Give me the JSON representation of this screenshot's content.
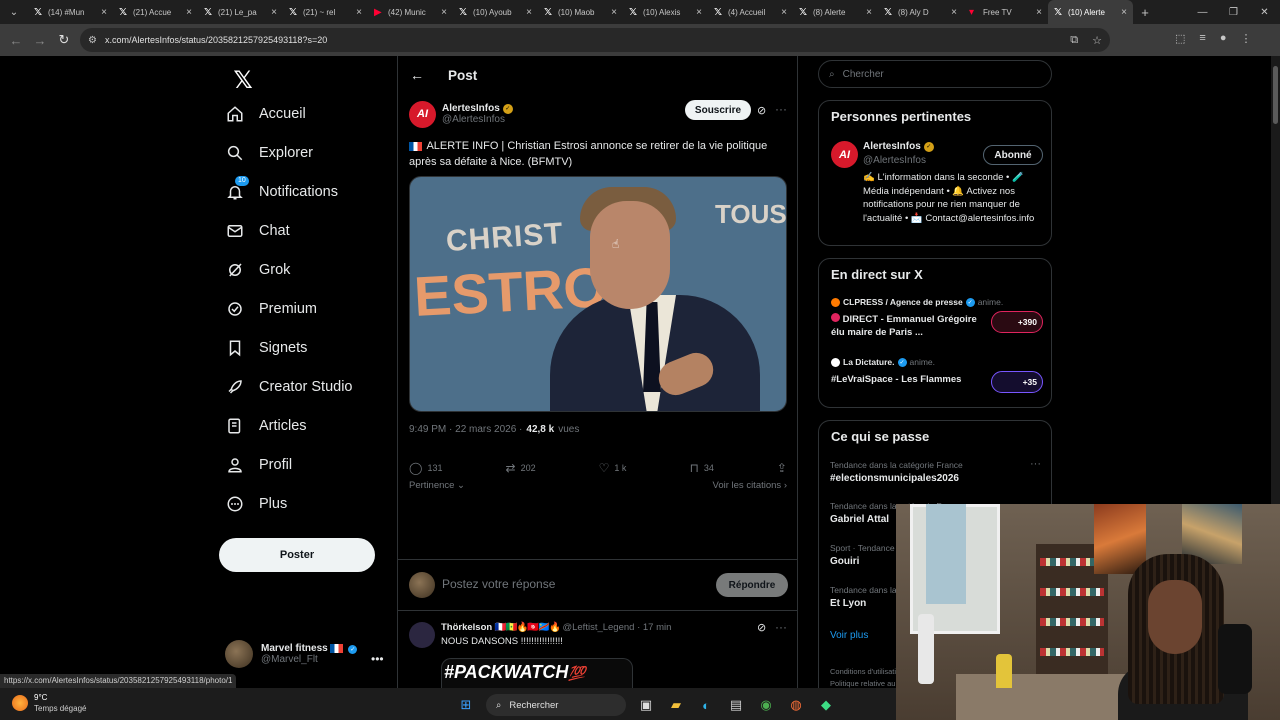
{
  "browser": {
    "tabs": [
      {
        "icon": "x-logo-icon",
        "title": "(14) #Mun"
      },
      {
        "icon": "x-logo-icon",
        "title": "(21) Accue"
      },
      {
        "icon": "x-logo-icon",
        "title": "(21) Le_pa"
      },
      {
        "icon": "x-logo-icon",
        "title": "(21) ~ rel"
      },
      {
        "icon": "youtube-icon",
        "title": "(42) Munic"
      },
      {
        "icon": "x-logo-icon",
        "title": "(10) Ayoub"
      },
      {
        "icon": "x-logo-icon",
        "title": "(10) Maob"
      },
      {
        "icon": "x-logo-icon",
        "title": "(10) Alexis"
      },
      {
        "icon": "x-logo-icon",
        "title": "(4) Accueil"
      },
      {
        "icon": "x-logo-icon",
        "title": "(8) Alerte"
      },
      {
        "icon": "x-logo-icon",
        "title": "(8) Aly D"
      },
      {
        "icon": "freetv-icon",
        "title": "Free TV"
      },
      {
        "icon": "x-logo-icon",
        "title": "(10) Alerte"
      }
    ],
    "url": "x.com/AlertesInfos/status/2035821257925493118?s=20",
    "status_url": "https://x.com/AlertesInfos/status/2035821257925493118/photo/1"
  },
  "sidebar": {
    "items": [
      {
        "icon": "home-icon",
        "label": "Accueil"
      },
      {
        "icon": "search-icon",
        "label": "Explorer"
      },
      {
        "icon": "bell-icon",
        "label": "Notifications",
        "badge": "10"
      },
      {
        "icon": "mail-icon",
        "label": "Chat"
      },
      {
        "icon": "grok-icon",
        "label": "Grok"
      },
      {
        "icon": "verified-icon",
        "label": "Premium"
      },
      {
        "icon": "bookmark-icon",
        "label": "Signets"
      },
      {
        "icon": "rocket-icon",
        "label": "Creator Studio"
      },
      {
        "icon": "article-icon",
        "label": "Articles"
      },
      {
        "icon": "person-icon",
        "label": "Profil"
      },
      {
        "icon": "more-circle-icon",
        "label": "Plus"
      }
    ],
    "post_label": "Poster",
    "account": {
      "name": "Marvel fitness",
      "handle": "@Marvel_Flt"
    }
  },
  "main": {
    "title": "Post",
    "post": {
      "author_name": "AlertesInfos",
      "author_handle": "@AlertesInfos",
      "subscribe_label": "Souscrire",
      "text": "ALERTE INFO | Christian Estrosi annonce se retirer de la vie politique après sa défaite à Nice. (BFMTV)",
      "photo_text": {
        "line1": "CHRIST",
        "line2": "ESTRO",
        "line3": "TOUS"
      },
      "time": "9:49 PM · 22 mars 2026 ·",
      "views": "42,8 k",
      "views_label": "vues",
      "replies": "131",
      "reposts": "202",
      "likes": "1 k",
      "bookmarks": "34",
      "sort_label": "Pertinence",
      "quotes_label": "Voir les citations"
    },
    "reply_box": {
      "placeholder": "Postez votre réponse",
      "button": "Répondre"
    },
    "reply": {
      "name": "Thörkelson",
      "emojis": "🇫🇷🇸🇳🔥🇹🇳🇨🇩🔥",
      "handle": "@Leftist_Legend · 17 min",
      "text": "NOUS DANSONS !!!!!!!!!!!!!!!!",
      "media_title": "#PACKWATCH",
      "media_emoji": "💯"
    }
  },
  "right": {
    "search_placeholder": "Chercher",
    "people": {
      "title": "Personnes pertinentes",
      "name": "AlertesInfos",
      "handle": "@AlertesInfos",
      "follow_label": "Abonné",
      "bio": "✍️ L'information dans la seconde • 🧪 Média indépendant • 🔔 Activez nos notifications pour ne rien manquer de l'actualité • 📩 Contact@alertesinfos.info"
    },
    "live": {
      "title": "En direct sur X",
      "items": [
        {
          "host": "CLPRESS / Agence de presse",
          "action": "anime.",
          "title": "DIRECT - Emmanuel Grégoire élu maire de Paris ...",
          "count": "+390",
          "color": "#e0245e"
        },
        {
          "host": "La Dictature.",
          "action": "anime.",
          "title": "#LeVraiSpace - Les Flammes",
          "count": "+35",
          "color": "#7856ff"
        }
      ]
    },
    "trends": {
      "title": "Ce qui se passe",
      "items": [
        {
          "category": "Tendance dans la catégorie France",
          "name": "#electionsmunicipales2026"
        },
        {
          "category": "Tendance dans la catégorie France",
          "name": "Gabriel Attal"
        },
        {
          "category": "Sport · Tendance",
          "name": "Gouiri"
        },
        {
          "category": "Tendance dans la catégorie France",
          "name": "Et Lyon"
        }
      ],
      "see_more": "Voir plus",
      "footer": "Conditions d'utilisation",
      "footer2": "Politique relative au"
    }
  },
  "taskbar": {
    "weather_temp": "9°C",
    "weather_desc": "Temps dégagé",
    "search_label": "Rechercher"
  }
}
